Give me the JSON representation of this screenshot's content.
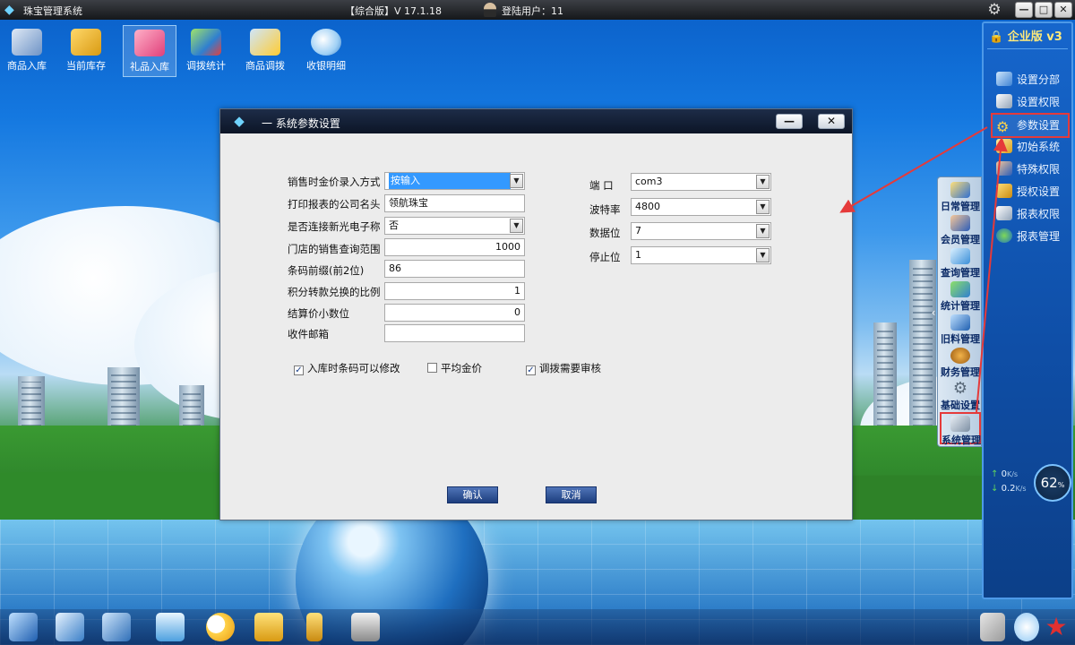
{
  "app": {
    "title": "珠宝管理系统",
    "version": "【综合版】V 17.1.18",
    "user_label": "登陆用户：11"
  },
  "window_controls": {
    "minimize": "—",
    "maximize": "□",
    "close": "✕"
  },
  "toolbar": [
    {
      "id": "goods-in",
      "label": "商品入库"
    },
    {
      "id": "stock",
      "label": "当前库存"
    },
    {
      "id": "gift-in",
      "label": "礼品入库",
      "active": true
    },
    {
      "id": "transfer-stats",
      "label": "调拨统计"
    },
    {
      "id": "goods-transfer",
      "label": "商品调拨"
    },
    {
      "id": "receipt-detail",
      "label": "收银明细"
    }
  ],
  "right_panel": {
    "edition": "企业版 v3",
    "items": [
      {
        "label": "设置分部"
      },
      {
        "label": "设置权限"
      },
      {
        "label": "参数设置",
        "highlighted": true
      },
      {
        "label": "初始系统"
      },
      {
        "label": "特殊权限"
      },
      {
        "label": "授权设置"
      },
      {
        "label": "报表权限"
      },
      {
        "label": "报表管理"
      }
    ]
  },
  "side_menu": [
    {
      "label": "日常管理"
    },
    {
      "label": "会员管理"
    },
    {
      "label": "查询管理"
    },
    {
      "label": "统计管理"
    },
    {
      "label": "旧料管理"
    },
    {
      "label": "财务管理"
    },
    {
      "label": "基础设置"
    },
    {
      "label": "系统管理",
      "highlighted": true
    }
  ],
  "network": {
    "upload": "0",
    "download": "0.2",
    "unit": "K/s",
    "percent": "62",
    "percent_unit": "%"
  },
  "dialog": {
    "title": "一  系统参数设置",
    "fields": {
      "gold_price_mode": {
        "label": "销售时金价录入方式",
        "value": "按输入"
      },
      "company_name": {
        "label": "打印报表的公司名头",
        "value": "领航珠宝"
      },
      "scale_connect": {
        "label": "是否连接新光电子称",
        "value": "否"
      },
      "query_range": {
        "label": "门店的销售查询范围",
        "value": "1000"
      },
      "barcode_prefix": {
        "label": "条码前缀(前2位)",
        "value": "86"
      },
      "points_ratio": {
        "label": "积分转款兑换的比例",
        "value": "1"
      },
      "settle_decimals": {
        "label": "结算价小数位",
        "value": "0"
      },
      "email": {
        "label": "收件邮箱",
        "value": ""
      },
      "port": {
        "label": "端    口",
        "value": "com3"
      },
      "baud": {
        "label": "波特率",
        "value": "4800"
      },
      "data_bits": {
        "label": "数据位",
        "value": "7"
      },
      "stop_bits": {
        "label": "停止位",
        "value": "1"
      }
    },
    "checks": {
      "barcode_editable": {
        "label": "入库时条码可以修改",
        "checked": true
      },
      "avg_gold": {
        "label": "平均金价",
        "checked": false
      },
      "transfer_review": {
        "label": "调拨需要审核",
        "checked": true
      }
    },
    "buttons": {
      "ok": "确认",
      "cancel": "取消"
    }
  },
  "colors": {
    "highlight": "#e53a3a",
    "panel_blue": "#1666cc",
    "dialog_title": "#0c1526"
  }
}
